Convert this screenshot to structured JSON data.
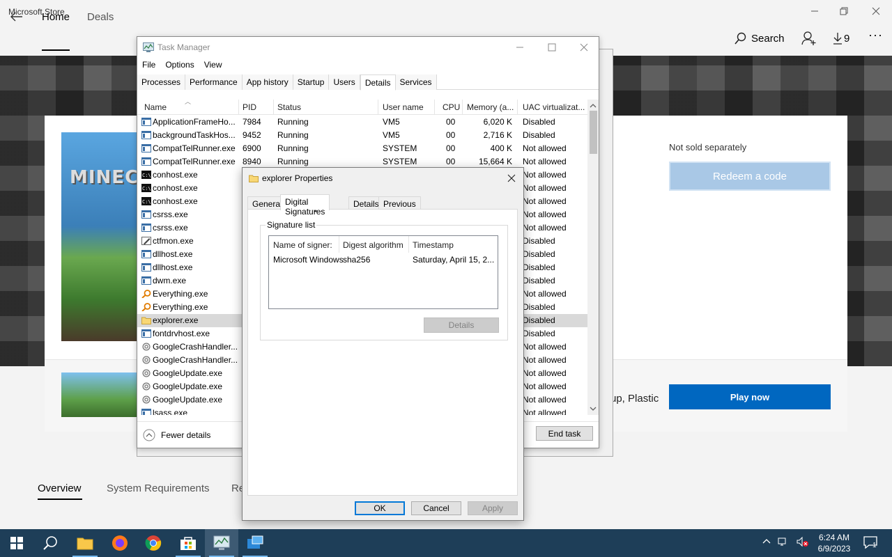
{
  "store": {
    "title": "Microsoft Store",
    "nav": {
      "home": "Home",
      "deals": "Deals",
      "search": "Search",
      "downloads_count": "9"
    },
    "boxart_logo": "MINEC",
    "not_sold": "Not sold separately",
    "redeem": "Redeem a code",
    "play_now": "Play now",
    "bundle_text": "up, Plastic",
    "subtabs": {
      "overview": "Overview",
      "sysreq": "System Requirements",
      "re": "Re"
    }
  },
  "task_manager": {
    "title": "Task Manager",
    "menu": [
      "File",
      "Options",
      "View"
    ],
    "tabs": [
      "Processes",
      "Performance",
      "App history",
      "Startup",
      "Users",
      "Details",
      "Services"
    ],
    "active_tab": "Details",
    "columns": [
      "Name",
      "PID",
      "Status",
      "User name",
      "CPU",
      "Memory (a...",
      "UAC virtualizat..."
    ],
    "rows": [
      {
        "icon": "app",
        "name": "ApplicationFrameHo...",
        "pid": "7984",
        "status": "Running",
        "user": "VM5",
        "cpu": "00",
        "mem": "6,020 K",
        "uac": "Disabled"
      },
      {
        "icon": "app",
        "name": "backgroundTaskHos...",
        "pid": "9452",
        "status": "Running",
        "user": "VM5",
        "cpu": "00",
        "mem": "2,716 K",
        "uac": "Disabled"
      },
      {
        "icon": "app",
        "name": "CompatTelRunner.exe",
        "pid": "6900",
        "status": "Running",
        "user": "SYSTEM",
        "cpu": "00",
        "mem": "400 K",
        "uac": "Not allowed"
      },
      {
        "icon": "app",
        "name": "CompatTelRunner.exe",
        "pid": "8940",
        "status": "Running",
        "user": "SYSTEM",
        "cpu": "00",
        "mem": "15,664 K",
        "uac": "Not allowed"
      },
      {
        "icon": "console",
        "name": "conhost.exe",
        "pid": "",
        "status": "",
        "user": "",
        "cpu": "",
        "mem": "",
        "uac": "Not allowed"
      },
      {
        "icon": "console",
        "name": "conhost.exe",
        "pid": "",
        "status": "",
        "user": "",
        "cpu": "",
        "mem": "",
        "uac": "Not allowed"
      },
      {
        "icon": "console",
        "name": "conhost.exe",
        "pid": "",
        "status": "",
        "user": "",
        "cpu": "",
        "mem": "",
        "uac": "Not allowed"
      },
      {
        "icon": "app",
        "name": "csrss.exe",
        "pid": "",
        "status": "",
        "user": "",
        "cpu": "",
        "mem": "",
        "uac": "Not allowed"
      },
      {
        "icon": "app",
        "name": "csrss.exe",
        "pid": "",
        "status": "",
        "user": "",
        "cpu": "",
        "mem": "",
        "uac": "Not allowed"
      },
      {
        "icon": "pen",
        "name": "ctfmon.exe",
        "pid": "",
        "status": "",
        "user": "",
        "cpu": "",
        "mem": "",
        "uac": "Disabled"
      },
      {
        "icon": "app",
        "name": "dllhost.exe",
        "pid": "",
        "status": "",
        "user": "",
        "cpu": "",
        "mem": "",
        "uac": "Disabled"
      },
      {
        "icon": "app",
        "name": "dllhost.exe",
        "pid": "",
        "status": "",
        "user": "",
        "cpu": "",
        "mem": "",
        "uac": "Disabled"
      },
      {
        "icon": "app",
        "name": "dwm.exe",
        "pid": "",
        "status": "",
        "user": "",
        "cpu": "",
        "mem": "",
        "uac": "Disabled"
      },
      {
        "icon": "search",
        "name": "Everything.exe",
        "pid": "",
        "status": "",
        "user": "",
        "cpu": "",
        "mem": "",
        "uac": "Not allowed"
      },
      {
        "icon": "search",
        "name": "Everything.exe",
        "pid": "",
        "status": "",
        "user": "",
        "cpu": "",
        "mem": "",
        "uac": "Disabled"
      },
      {
        "icon": "folder",
        "name": "explorer.exe",
        "pid": "",
        "status": "",
        "user": "",
        "cpu": "",
        "mem": "",
        "uac": "Disabled",
        "selected": true
      },
      {
        "icon": "app",
        "name": "fontdrvhost.exe",
        "pid": "",
        "status": "",
        "user": "",
        "cpu": "",
        "mem": "",
        "uac": "Disabled"
      },
      {
        "icon": "gear",
        "name": "GoogleCrashHandler...",
        "pid": "",
        "status": "",
        "user": "",
        "cpu": "",
        "mem": "",
        "uac": "Not allowed"
      },
      {
        "icon": "gear",
        "name": "GoogleCrashHandler...",
        "pid": "",
        "status": "",
        "user": "",
        "cpu": "",
        "mem": "",
        "uac": "Not allowed"
      },
      {
        "icon": "gear",
        "name": "GoogleUpdate.exe",
        "pid": "",
        "status": "",
        "user": "",
        "cpu": "",
        "mem": "",
        "uac": "Not allowed"
      },
      {
        "icon": "gear",
        "name": "GoogleUpdate.exe",
        "pid": "",
        "status": "",
        "user": "",
        "cpu": "",
        "mem": "",
        "uac": "Not allowed"
      },
      {
        "icon": "gear",
        "name": "GoogleUpdate.exe",
        "pid": "",
        "status": "",
        "user": "",
        "cpu": "",
        "mem": "",
        "uac": "Not allowed"
      },
      {
        "icon": "app",
        "name": "lsass.exe",
        "pid": "",
        "status": "",
        "user": "",
        "cpu": "",
        "mem": "",
        "uac": "Not allowed"
      }
    ],
    "fewer_details": "Fewer details",
    "end_task": "End task"
  },
  "properties": {
    "title": "explorer Properties",
    "tabs": [
      "General",
      "Digital Signatures",
      "Details",
      "Previous Versions"
    ],
    "active_tab": "Digital Signatures",
    "signature_list_label": "Signature list",
    "columns": [
      "Name of signer:",
      "Digest algorithm",
      "Timestamp"
    ],
    "signer": "Microsoft Windows",
    "digest": "sha256",
    "timestamp": "Saturday, April 15, 2...",
    "details_button": "Details",
    "ok": "OK",
    "cancel": "Cancel",
    "apply": "Apply"
  },
  "taskbar": {
    "time": "6:24 AM",
    "date": "6/9/2023",
    "notification_count": "1"
  },
  "colors": {
    "accent": "#0067c0",
    "selection": "#cce8ff",
    "taskbar": "#1e3e58"
  }
}
